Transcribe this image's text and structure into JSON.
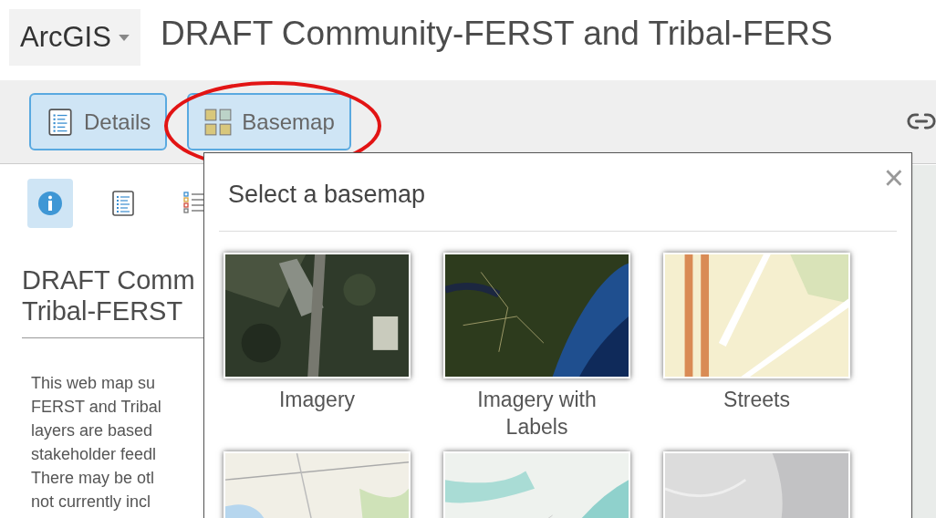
{
  "header": {
    "app_menu": "ArcGIS",
    "title": "DRAFT Community-FERST and Tribal-FERS"
  },
  "toolbar": {
    "buttons": [
      {
        "label": "Details",
        "selected": true,
        "highlighted": false
      },
      {
        "label": "Basemap",
        "selected": true,
        "highlighted": true
      }
    ]
  },
  "side_panel": {
    "tools": [
      {
        "kind": "info",
        "selected": true
      },
      {
        "kind": "content",
        "selected": false
      },
      {
        "kind": "legend",
        "selected": false
      }
    ],
    "title_lines": [
      "DRAFT Comm",
      "Tribal-FERST"
    ],
    "description_lines": [
      "This web map su",
      "FERST and Tribal",
      "layers are based",
      "stakeholder feedl",
      "There may be otl",
      "not currently incl"
    ]
  },
  "basemap_gallery": {
    "title": "Select a basemap",
    "close": "×",
    "items": [
      {
        "kind": "picture",
        "label": "Imagery"
      },
      {
        "kind": "picture",
        "label": "Imagery with Labels"
      },
      {
        "kind": "picture",
        "label": "Streets"
      },
      {
        "kind": "picture"
      },
      {
        "kind": "picture"
      },
      {
        "kind": "picture"
      }
    ]
  }
}
